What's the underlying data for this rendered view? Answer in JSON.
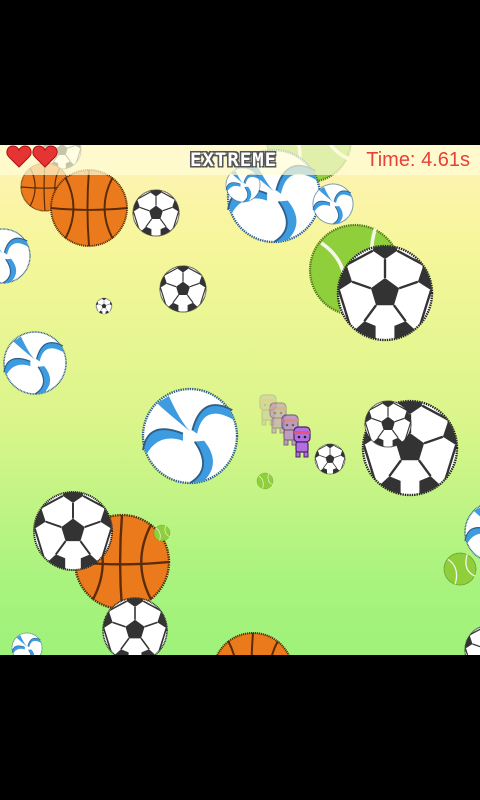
{
  "hud": {
    "lives": 2,
    "mode": "EXTREME",
    "time_label": "Time:",
    "time_value": "4.61s"
  },
  "colors": {
    "heart": "#e63333",
    "timer_text": "#e8403a",
    "volleyball_blue": "#3d9be0",
    "basketball_orange": "#ea7a1c",
    "tennis_green": "#8fcf3c",
    "player_purple": "#b36ee0",
    "player_headband": "#e5557a"
  },
  "entities": {
    "balls": [
      "soccer-ball",
      "basketball",
      "volleyball",
      "tennis-ball"
    ],
    "player": "ninja-character"
  }
}
